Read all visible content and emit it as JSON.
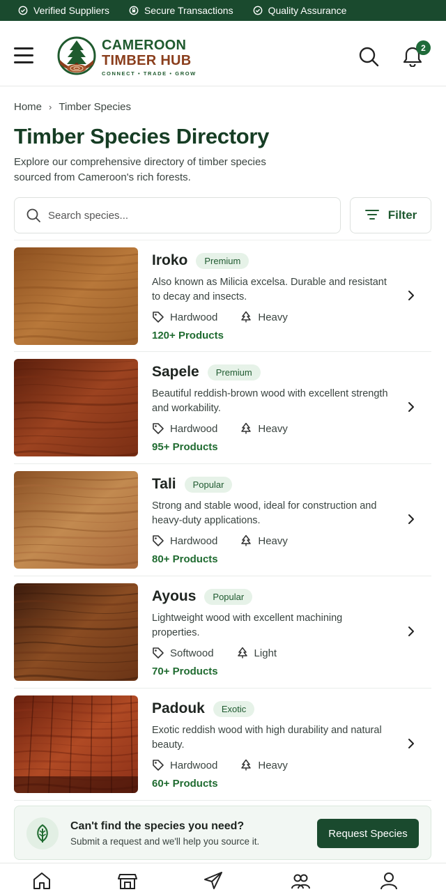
{
  "trust_bar": {
    "items": [
      {
        "label": "Verified Suppliers",
        "icon": "verified-check-icon"
      },
      {
        "label": "Secure Transactions",
        "icon": "shield-lock-icon"
      },
      {
        "label": "Quality Assurance",
        "icon": "quality-check-icon"
      }
    ]
  },
  "header": {
    "brand_line1": "CAMEROON",
    "brand_line2": "TIMBER HUB",
    "brand_tagline": "CONNECT • TRADE • GROW",
    "notification_count": "2"
  },
  "breadcrumb": {
    "home": "Home",
    "separator": "›",
    "current": "Timber Species"
  },
  "page": {
    "title": "Timber Species Directory",
    "description": "Explore our comprehensive directory of timber species sourced from Cameroon's rich forests."
  },
  "search": {
    "placeholder": "Search species...",
    "value": ""
  },
  "filter": {
    "label": "Filter"
  },
  "species": [
    {
      "name": "Iroko",
      "tag": "Premium",
      "description": "Also known as Milicia excelsa. Durable and resistant to decay and insects.",
      "type": "Hardwood",
      "weight": "Heavy",
      "products": "120+ Products",
      "colors": [
        "#8c4f1f",
        "#b8783a",
        "#9a5e28"
      ]
    },
    {
      "name": "Sapele",
      "tag": "Premium",
      "description": "Beautiful reddish-brown wood with excellent strength and workability.",
      "type": "Hardwood",
      "weight": "Heavy",
      "products": "95+ Products",
      "colors": [
        "#5a1e0c",
        "#9c4320",
        "#7a2e14"
      ]
    },
    {
      "name": "Tali",
      "tag": "Popular",
      "description": "Strong and stable wood, ideal for construction and heavy-duty applications.",
      "type": "Hardwood",
      "weight": "Heavy",
      "products": "80+ Products",
      "colors": [
        "#8a5024",
        "#c28a50",
        "#a8683a"
      ]
    },
    {
      "name": "Ayous",
      "tag": "Popular",
      "description": "Lightweight wood with excellent machining properties.",
      "type": "Softwood",
      "weight": "Light",
      "products": "70+ Products",
      "colors": [
        "#3a1a0c",
        "#8a4c22",
        "#6a3416"
      ]
    },
    {
      "name": "Padouk",
      "tag": "Exotic",
      "description": "Exotic reddish wood with high durability and natural beauty.",
      "type": "Hardwood",
      "weight": "Heavy",
      "products": "60+ Products",
      "colors": [
        "#6a200e",
        "#b04a24",
        "#8c3018"
      ]
    }
  ],
  "request": {
    "title": "Can't find the species you need?",
    "subtitle": "Submit a request and we'll help you source it.",
    "button": "Request Species"
  },
  "bottom_nav": {
    "items": [
      {
        "icon": "home-icon"
      },
      {
        "icon": "store-icon"
      },
      {
        "icon": "send-icon"
      },
      {
        "icon": "community-icon"
      },
      {
        "icon": "profile-icon"
      }
    ]
  },
  "colors": {
    "brand_dark_green": "#1a4a2e",
    "brand_green": "#1f6b30",
    "brand_brown": "#8a3e1c",
    "tag_bg": "#e6f2e8"
  }
}
